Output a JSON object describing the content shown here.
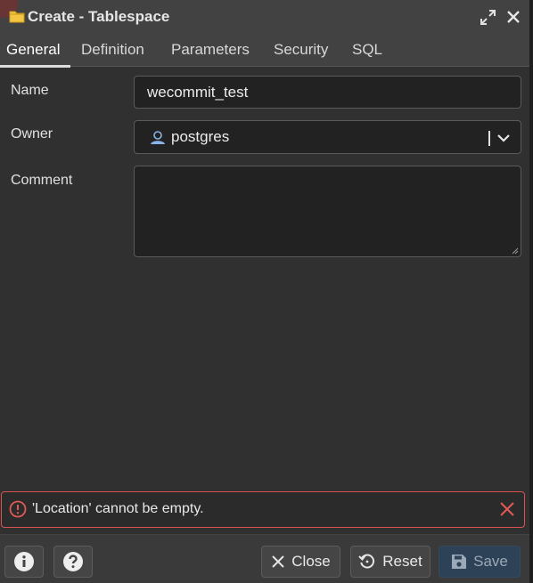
{
  "window": {
    "title": "Create - Tablespace"
  },
  "tabs": [
    {
      "label": "General",
      "active": true
    },
    {
      "label": "Definition",
      "active": false
    },
    {
      "label": "Parameters",
      "active": false
    },
    {
      "label": "Security",
      "active": false
    },
    {
      "label": "SQL",
      "active": false
    }
  ],
  "form": {
    "name": {
      "label": "Name",
      "value": "wecommit_test"
    },
    "owner": {
      "label": "Owner",
      "value": "postgres"
    },
    "comment": {
      "label": "Comment",
      "value": ""
    }
  },
  "error": {
    "message": "'Location' cannot be empty."
  },
  "footer": {
    "close_label": "Close",
    "reset_label": "Reset",
    "save_label": "Save"
  },
  "colors": {
    "error_border": "#d9534f",
    "save_bg": "#2e4257",
    "folder": "#f4c542",
    "user_icon": "#8ab4e8"
  }
}
